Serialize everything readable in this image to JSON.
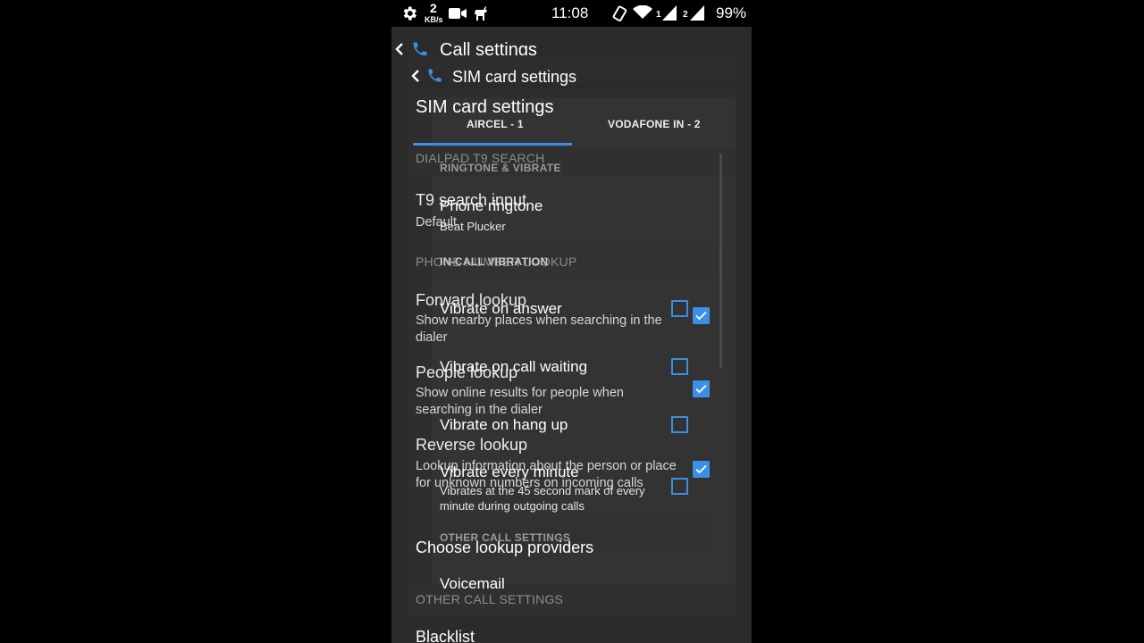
{
  "status_bar": {
    "speed_value": "2",
    "speed_unit": "KB/s",
    "time": "11:08",
    "sim1": "1",
    "sim2": "2",
    "battery": "99%",
    "icons": [
      "gear-icon",
      "camcorder-icon",
      "deer-icon",
      "vibrate-icon",
      "wifi-icon",
      "signal-icon",
      "signal-icon",
      "battery-icon"
    ]
  },
  "header": {
    "call_settings_title": "Call settings",
    "sim_card_settings_crumb": "SIM card settings",
    "sim_card_settings_title": "SIM card settings"
  },
  "tabs": [
    {
      "label": "AIRCEL - 1",
      "selected": true
    },
    {
      "label": "VODAFONE IN - 2",
      "selected": false
    }
  ],
  "accent": "#3b8fe6",
  "back_layer": {
    "cat_dialpad": "DIALPAD T9 SEARCH",
    "t9_title": "T9 search input",
    "t9_value": "Default",
    "cat_phone_lookup": "PHONE NUMBER LOOKUP",
    "forward_title": "Forward lookup",
    "forward_desc": "Show nearby places when searching in the dialer",
    "forward_checked": true,
    "people_title": "People lookup",
    "people_desc": "Show online results for people when searching in the dialer",
    "people_checked": true,
    "reverse_title": "Reverse lookup",
    "reverse_desc": "Lookup information about the person or place for unknown numbers on incoming calls",
    "reverse_checked": true,
    "choose_title": "Choose lookup providers",
    "cat_other": "OTHER CALL SETTINGS",
    "blacklist_title": "Blacklist"
  },
  "front_layer": {
    "cat_ringtone": "RINGTONE & VIBRATE",
    "ringtone_title": "Phone ringtone",
    "ringtone_value": "Beat Plucker",
    "cat_incall": "IN-CALL VIBRATION",
    "vib_answer": "Vibrate on answer",
    "vib_answer_checked": false,
    "vib_waiting": "Vibrate on call waiting",
    "vib_waiting_checked": false,
    "vib_hangup": "Vibrate on hang up",
    "vib_hangup_checked": false,
    "vib_minute": "Vibrate every minute",
    "vib_minute_desc": "Vibrates at the 45 second mark of every minute during outgoing calls",
    "vib_minute_checked": false,
    "cat_other": "OTHER CALL SETTINGS",
    "voicemail_title": "Voicemail"
  }
}
